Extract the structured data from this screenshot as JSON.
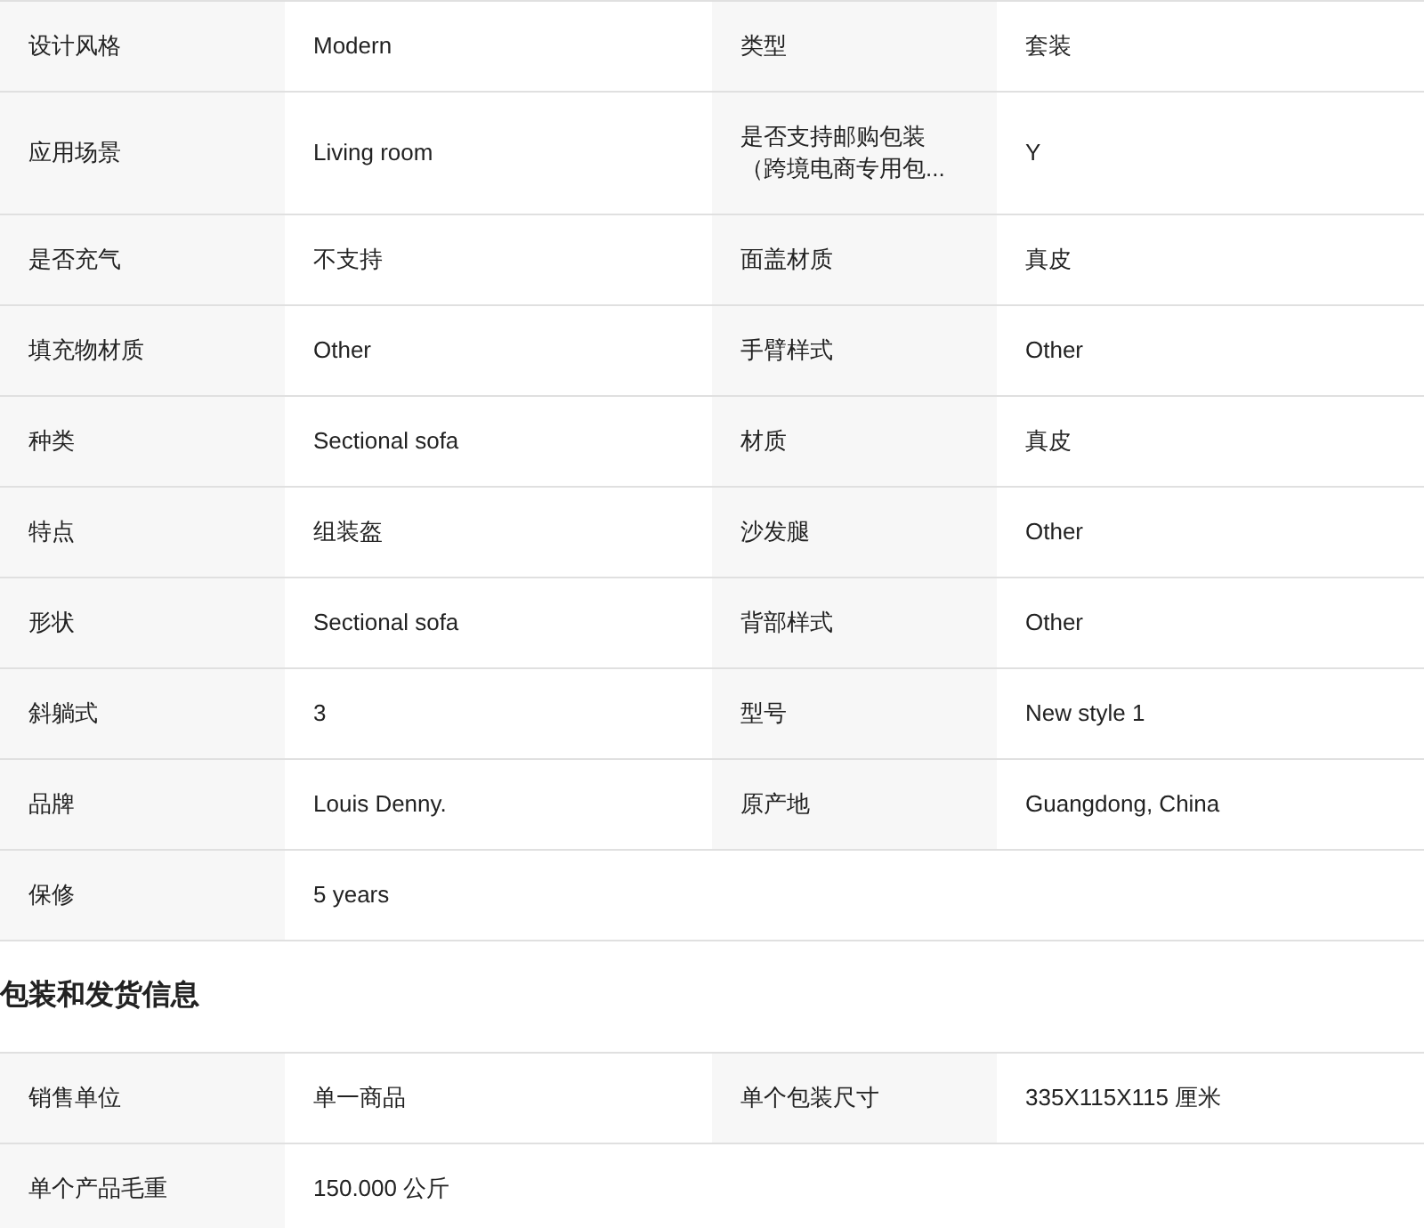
{
  "attributes": [
    [
      {
        "label": "设计风格",
        "value": "Modern"
      },
      {
        "label": "类型",
        "value": "套装"
      }
    ],
    [
      {
        "label": "应用场景",
        "value": "Living room"
      },
      {
        "label": "是否支持邮购包装（跨境电商专用包...",
        "value": "Y"
      }
    ],
    [
      {
        "label": "是否充气",
        "value": "不支持"
      },
      {
        "label": "面盖材质",
        "value": "真皮"
      }
    ],
    [
      {
        "label": "填充物材质",
        "value": "Other"
      },
      {
        "label": "手臂样式",
        "value": "Other"
      }
    ],
    [
      {
        "label": "种类",
        "value": "Sectional sofa"
      },
      {
        "label": "材质",
        "value": "真皮"
      }
    ],
    [
      {
        "label": "特点",
        "value": "组装盔"
      },
      {
        "label": "沙发腿",
        "value": "Other"
      }
    ],
    [
      {
        "label": "形状",
        "value": "Sectional sofa"
      },
      {
        "label": "背部样式",
        "value": "Other"
      }
    ],
    [
      {
        "label": "斜躺式",
        "value": "3"
      },
      {
        "label": "型号",
        "value": "New style 1"
      }
    ],
    [
      {
        "label": "品牌",
        "value": "Louis Denny."
      },
      {
        "label": "原产地",
        "value": "Guangdong, China"
      }
    ],
    [
      {
        "label": "保修",
        "value": "5 years"
      }
    ]
  ],
  "packaging": {
    "title": "包装和发货信息",
    "rows": [
      [
        {
          "label": "销售单位",
          "value": "单一商品"
        },
        {
          "label": "单个包装尺寸",
          "value": "335X115X115 厘米"
        }
      ],
      [
        {
          "label": "单个产品毛重",
          "value": "150.000 公斤"
        }
      ]
    ]
  }
}
